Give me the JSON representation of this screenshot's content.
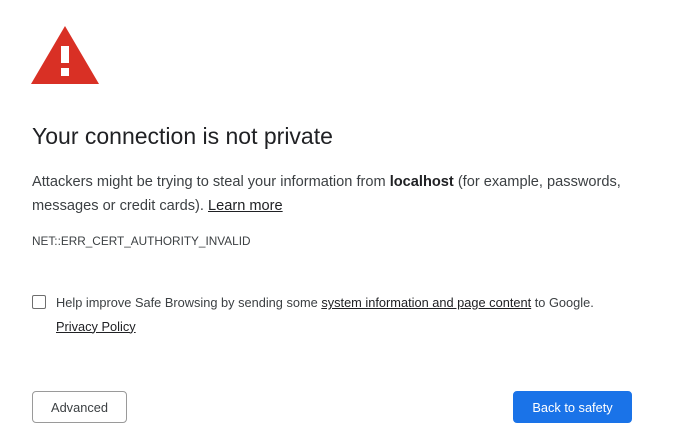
{
  "icon": {
    "name": "warning-triangle-icon",
    "color": "#d93025"
  },
  "heading": "Your connection is not private",
  "explanation": {
    "prefix": "Attackers might be trying to steal your information from ",
    "host": "localhost",
    "suffix": " (for example, passwords, messages or credit cards). ",
    "learn_more": "Learn more"
  },
  "error_code": "NET::ERR_CERT_AUTHORITY_INVALID",
  "safe_browsing": {
    "checked": false,
    "prefix": "Help improve Safe Browsing by sending some ",
    "link1": "system information and page content",
    "middle": " to Google. ",
    "link2": "Privacy Policy"
  },
  "buttons": {
    "advanced": "Advanced",
    "back_to_safety": "Back to safety"
  },
  "colors": {
    "primary_button": "#1a73e8",
    "warning": "#d93025"
  }
}
